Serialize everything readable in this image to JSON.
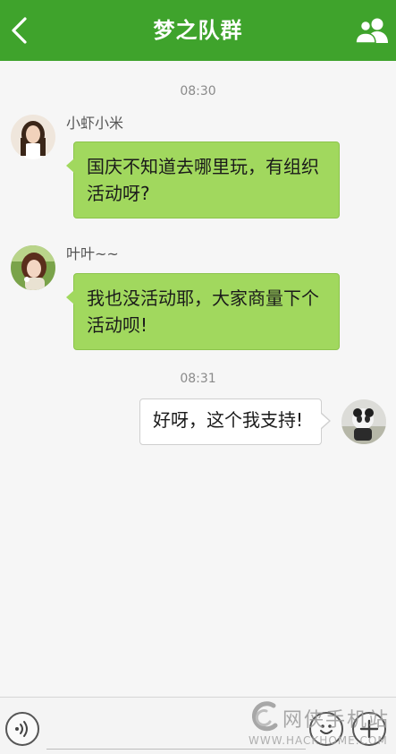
{
  "header": {
    "title": "梦之队群",
    "back_icon": "chevron-left-icon",
    "members_icon": "group-members-icon",
    "background_color": "#3fa32c"
  },
  "messages": [
    {
      "time": "08:30",
      "sender": "小虾小米",
      "text_lines": [
        "国庆不知道去哪里玩，有组织",
        "活动呀?"
      ],
      "direction": "incoming"
    },
    {
      "sender": "叶叶~~",
      "text_lines": [
        "我也没活动耶，大家商量下个",
        "活动呗!"
      ],
      "direction": "incoming"
    },
    {
      "time": "08:31",
      "text_lines": [
        "好呀，这个我支持!"
      ],
      "direction": "outgoing"
    }
  ],
  "bottom_bar": {
    "voice_icon": "voice-icon",
    "input_value": "",
    "emoji_icon": "emoji-icon",
    "plus_icon": "plus-icon"
  },
  "watermark": {
    "brand": "网侠手机站",
    "url": "WWW.HACKHOME.COM"
  },
  "colors": {
    "incoming_bubble": "#a1d85e",
    "outgoing_bubble": "#ffffff",
    "background": "#f6f6f6"
  }
}
